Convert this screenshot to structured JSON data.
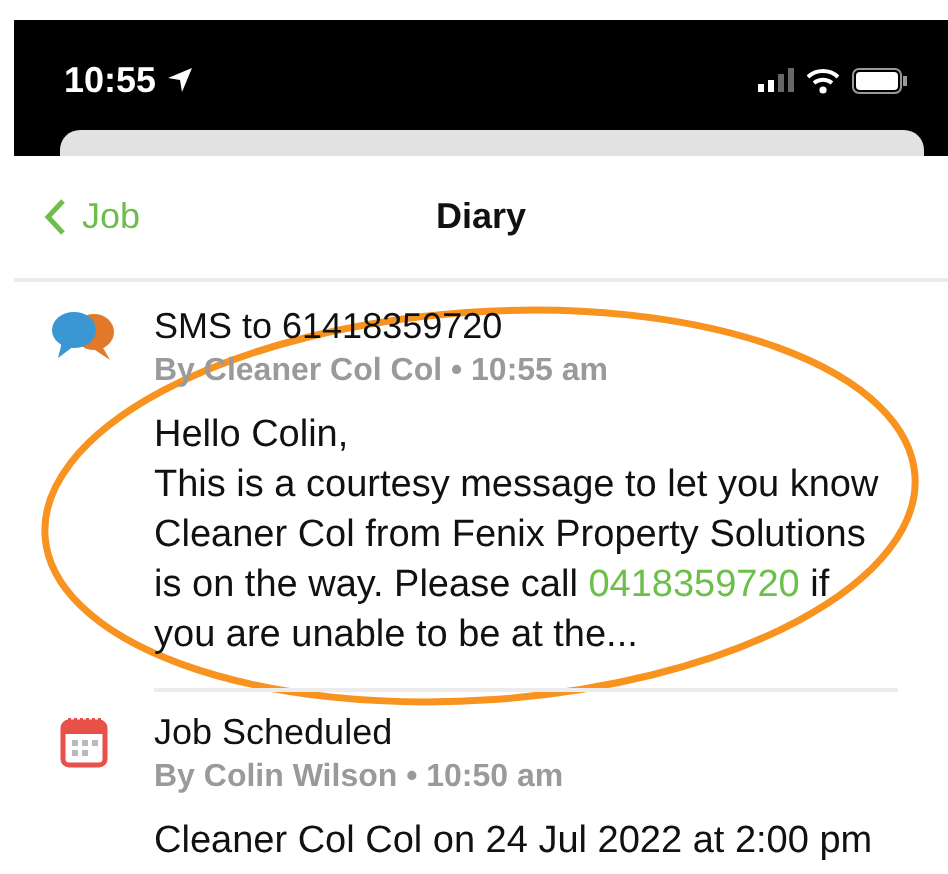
{
  "status_bar": {
    "time": "10:55"
  },
  "nav": {
    "back": "Job",
    "title": "Diary"
  },
  "entries": [
    {
      "kind": "sms",
      "title": "SMS to 61418359720",
      "meta": "By Cleaner Col Col • 10:55 am",
      "greeting": "Hello Colin,",
      "body": [
        {
          "kind": "text",
          "text": "This is a courtesy message to let you know Cleaner Col from Fenix Property Solutions is on the way. Please call "
        },
        {
          "kind": "link",
          "text": "0418359720"
        },
        {
          "kind": "text",
          "text": " if you are unable to be at the..."
        }
      ]
    },
    {
      "kind": "schedule",
      "title": "Job Scheduled",
      "meta": "By Colin Wilson • 10:50 am",
      "body": [
        {
          "kind": "text",
          "text": "Cleaner Col Col on 24 Jul 2022 at 2:00 pm"
        }
      ]
    }
  ],
  "highlight": {
    "kind": "ellipse"
  }
}
